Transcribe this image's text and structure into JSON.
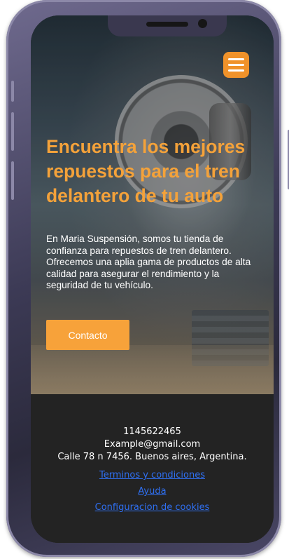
{
  "hero": {
    "title": "Encuentra los mejores repuestos para el tren delantero de tu auto",
    "description": "En Maria Suspensión, somos tu tienda de confianza para repuestos de tren delantero. Ofrecemos una aplia gama de productos de alta calidad para asegurar el rendimiento y la seguridad de tu vehículo.",
    "contact_button": "Contacto"
  },
  "menu": {
    "icon": "hamburger-menu-icon"
  },
  "footer": {
    "phone": "1145622465",
    "email": "Example@gmail.com",
    "address": "Calle 78 n 7456. Buenos aires, Argentina.",
    "links": [
      {
        "label": "Terminos y condiciones"
      },
      {
        "label": "Ayuda"
      },
      {
        "label": "Configuracion de cookies"
      }
    ]
  },
  "colors": {
    "accent": "#f7a23a",
    "footer_bg": "#232323",
    "link": "#2f6ff0",
    "phone_frame": "#4a4766"
  }
}
